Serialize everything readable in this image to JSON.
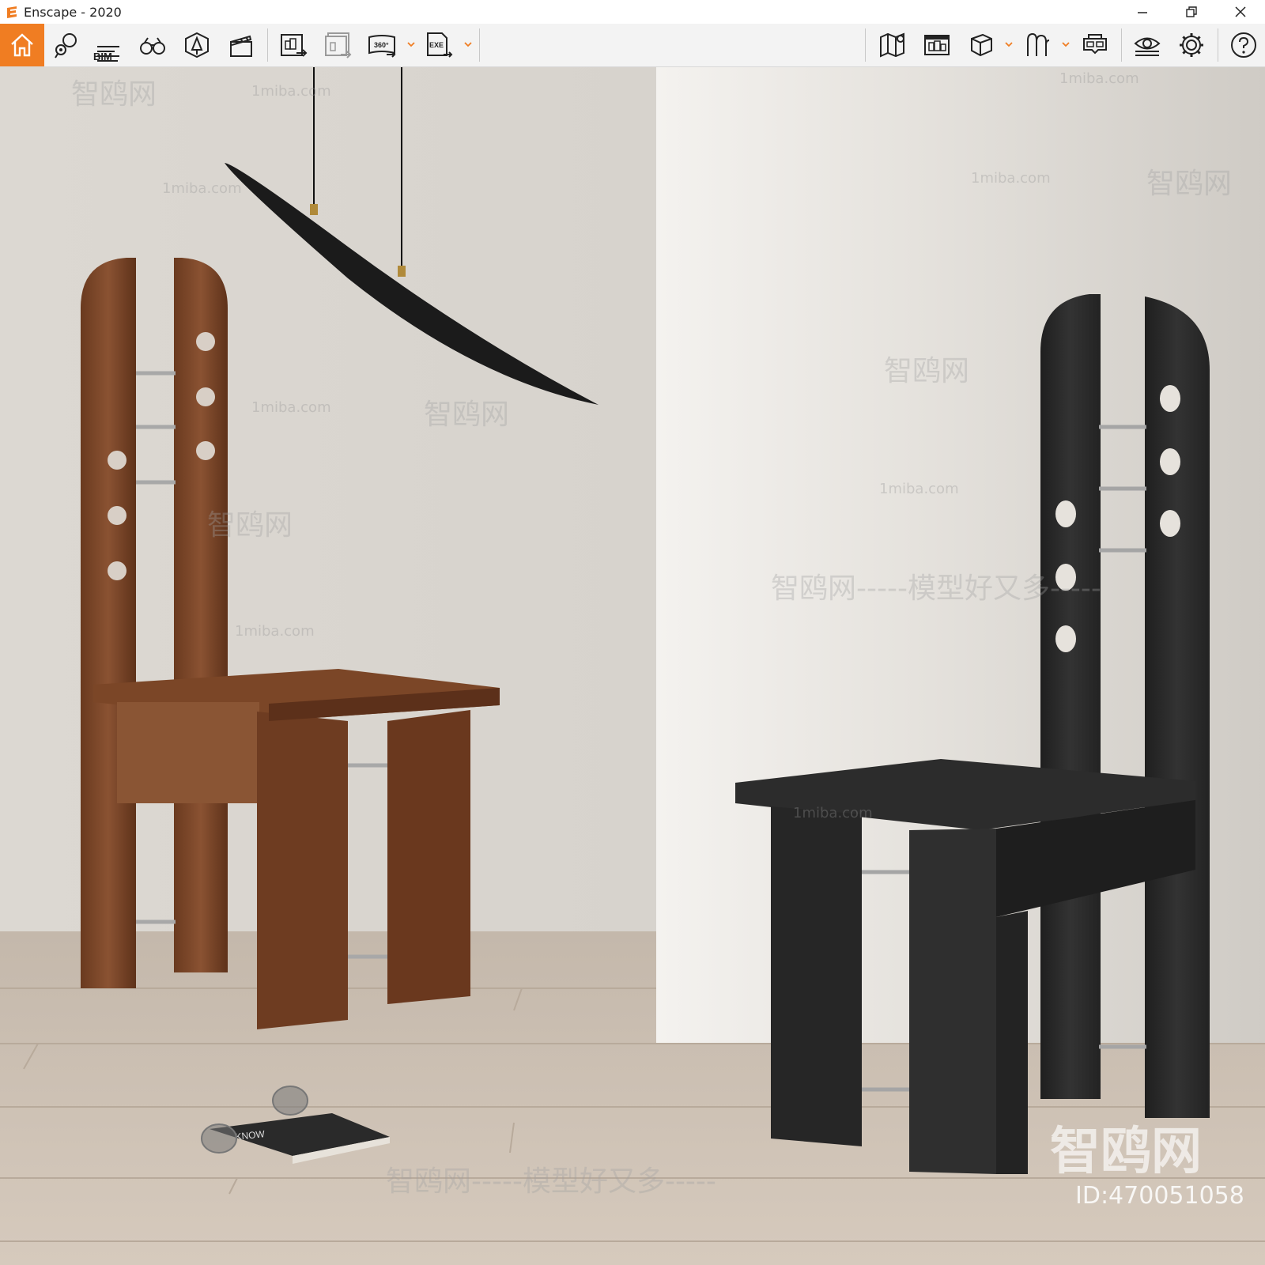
{
  "window": {
    "title": "Enscape - 2020"
  },
  "toolbar": {
    "home": "home",
    "bim_label": "BIM",
    "icons": [
      "home-icon",
      "marker-icon",
      "bim-icon",
      "binoculars-icon",
      "asset-library-icon",
      "clapperboard-icon",
      "screenshot-icon",
      "batch-render-icon",
      "panorama-360-icon",
      "export-exe-icon",
      "map-icon",
      "view-management-icon",
      "cube-icon",
      "atmosphere-icon",
      "vr-headset-icon",
      "visibility-icon",
      "settings-icon",
      "help-icon"
    ],
    "panorama_label": "360°",
    "exe_label": "EXE"
  },
  "viewport": {
    "watermarks": {
      "site": "1miba.com",
      "brand": "智鸥网",
      "slogan": "智鸥网-----模型好又多-----",
      "big_brand": "智鸥网",
      "id": "ID:470051058"
    },
    "book_text": "KNOW"
  },
  "colors": {
    "accent": "#f07d22",
    "wall": "#e3dfda",
    "floor": "#cfc2b4",
    "walnut": "#7a4526",
    "black_wood": "#2a2a2a"
  }
}
